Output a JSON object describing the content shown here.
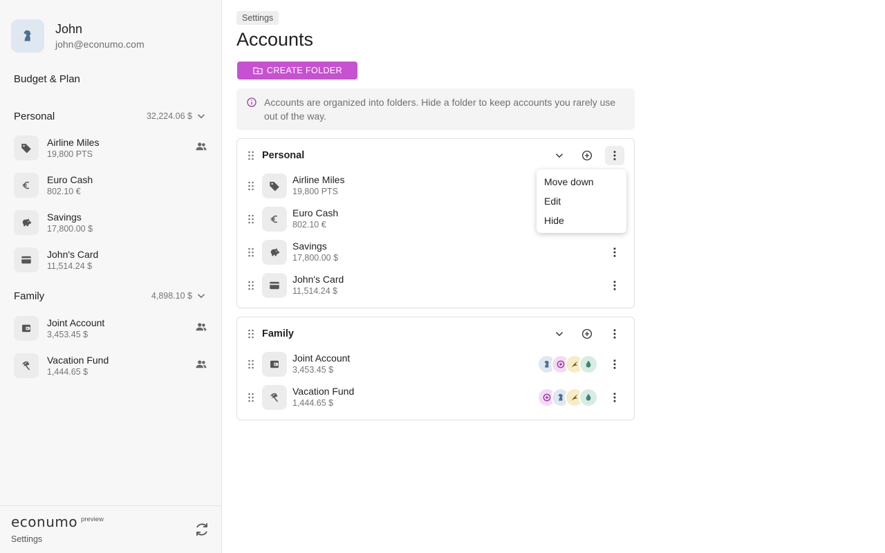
{
  "user": {
    "name": "John",
    "email": "john@econumo.com"
  },
  "sidebar": {
    "budget_link": "Budget & Plan",
    "folders": [
      {
        "name": "Personal",
        "total": "32,224.06 $",
        "accounts": [
          {
            "name": "Airline Miles",
            "balance": "19,800 PTS",
            "icon": "tag-icon",
            "shared": true
          },
          {
            "name": "Euro Cash",
            "balance": "802.10 €",
            "icon": "euro-icon",
            "shared": false
          },
          {
            "name": "Savings",
            "balance": "17,800.00 $",
            "icon": "piggy-bank-icon",
            "shared": false
          },
          {
            "name": "John's Card",
            "balance": "11,514.24 $",
            "icon": "credit-card-icon",
            "shared": false
          }
        ]
      },
      {
        "name": "Family",
        "total": "4,898.10 $",
        "accounts": [
          {
            "name": "Joint Account",
            "balance": "3,453.45 $",
            "icon": "wallet-icon",
            "shared": true
          },
          {
            "name": "Vacation Fund",
            "balance": "1,444.65 $",
            "icon": "beach-umbrella-icon",
            "shared": true
          }
        ]
      }
    ],
    "footer": {
      "logo": "econumo",
      "logo_badge": "preview",
      "settings_label": "Settings"
    }
  },
  "main": {
    "breadcrumb": "Settings",
    "title": "Accounts",
    "create_folder_label": "CREATE FOLDER",
    "info_text": "Accounts are organized into folders. Hide a folder to keep accounts you rarely use out of the way.",
    "folders": [
      {
        "name": "Personal",
        "accounts": [
          {
            "name": "Airline Miles",
            "balance": "19,800 PTS",
            "icon": "tag-icon"
          },
          {
            "name": "Euro Cash",
            "balance": "802.10 €",
            "icon": "euro-icon"
          },
          {
            "name": "Savings",
            "balance": "17,800.00 $",
            "icon": "piggy-bank-icon"
          },
          {
            "name": "John's Card",
            "balance": "11,514.24 $",
            "icon": "credit-card-icon"
          }
        ]
      },
      {
        "name": "Family",
        "accounts": [
          {
            "name": "Joint Account",
            "balance": "3,453.45 $",
            "icon": "wallet-icon"
          },
          {
            "name": "Vacation Fund",
            "balance": "1,444.65 $",
            "icon": "beach-umbrella-icon"
          }
        ]
      }
    ],
    "context_menu": {
      "items": [
        "Move down",
        "Edit",
        "Hide"
      ]
    }
  },
  "colors": {
    "accent": "#c651d1",
    "avatar_blue": "#dfe8f0",
    "avatar_purple": "#f1dcf2",
    "avatar_yellow": "#f7ecc4",
    "avatar_green": "#d8ebe4"
  }
}
